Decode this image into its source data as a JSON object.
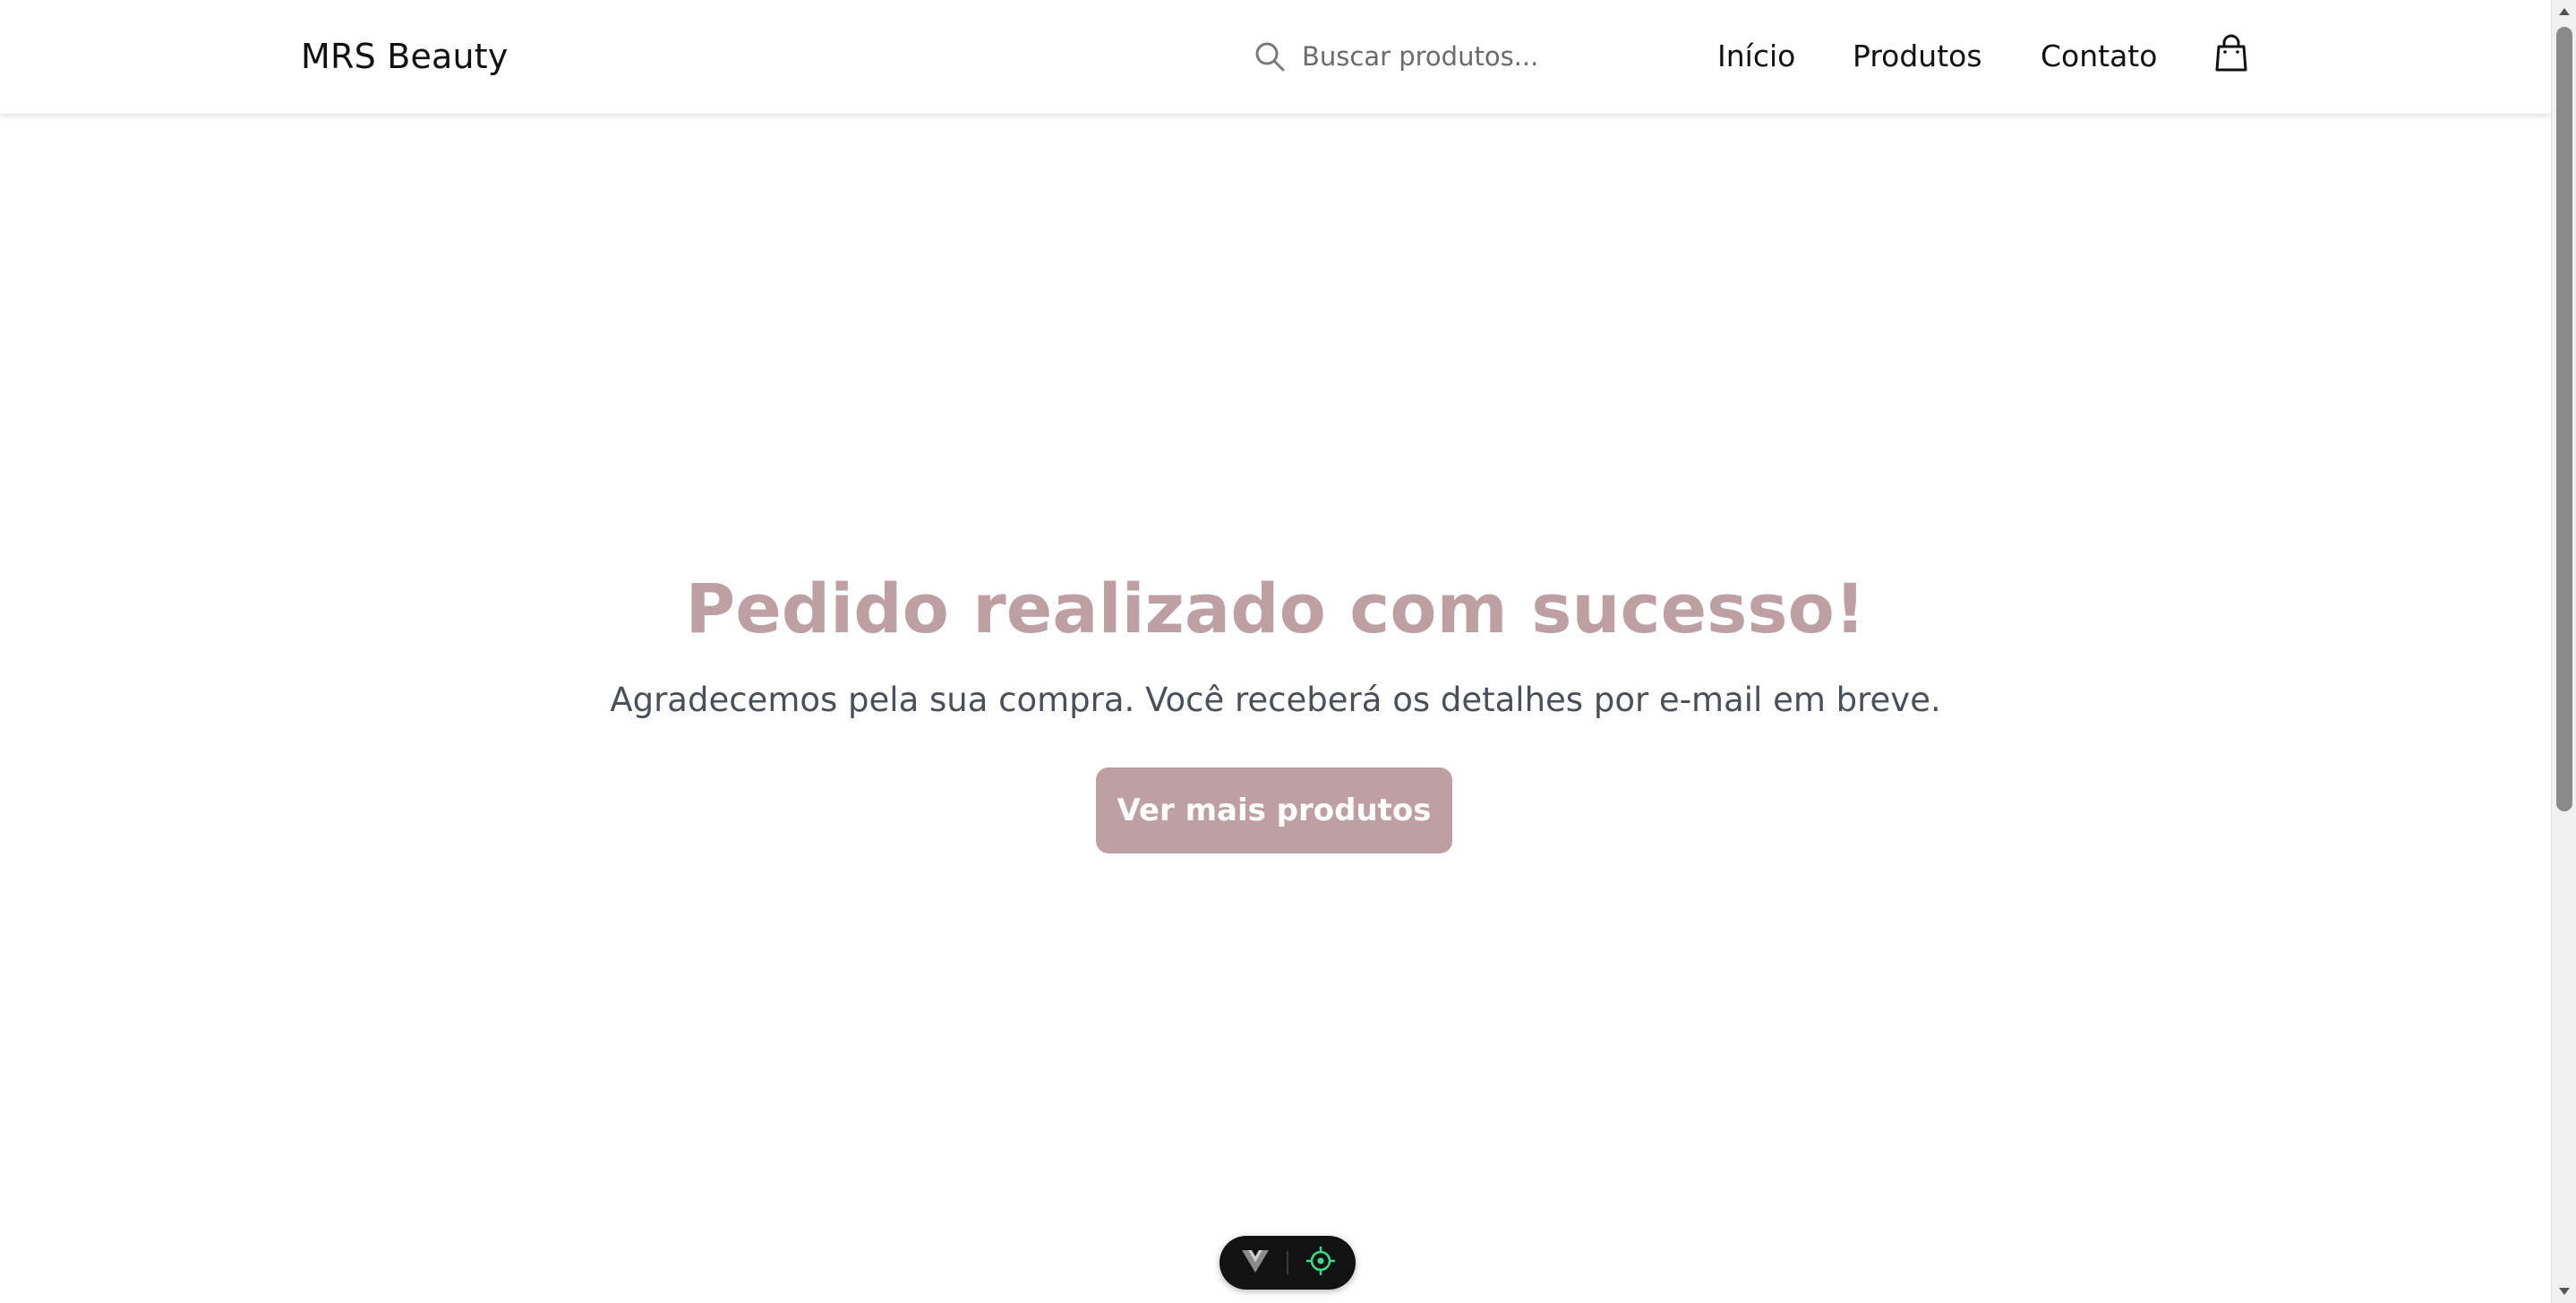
{
  "header": {
    "logo": "MRS Beauty",
    "search": {
      "placeholder": "Buscar produtos...",
      "value": "",
      "icon": "search-icon"
    },
    "nav": [
      {
        "label": "Início"
      },
      {
        "label": "Produtos"
      },
      {
        "label": "Contato"
      }
    ],
    "cart_icon": "shopping-bag-icon"
  },
  "main": {
    "title": "Pedido realizado com sucesso!",
    "subtitle": "Agradecemos pela sua compra. Você receberá os detalhes por e-mail em breve.",
    "cta_label": "Ver mais produtos"
  },
  "devtools_pill": {
    "icons": [
      "vue-logo-icon",
      "target-icon"
    ]
  },
  "colors": {
    "accent": "#bd9fa4",
    "text_dark": "#111111",
    "text_muted": "#4a4f5a",
    "pill_bg": "#121212",
    "target_green": "#3ddc84"
  }
}
